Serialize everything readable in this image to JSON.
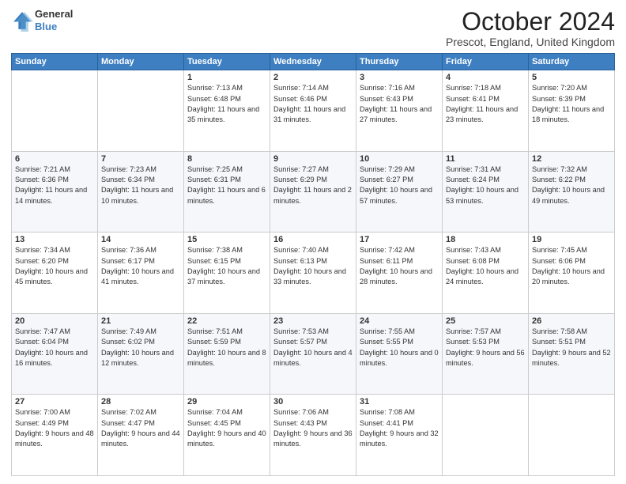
{
  "header": {
    "logo_line1": "General",
    "logo_line2": "Blue",
    "month": "October 2024",
    "location": "Prescot, England, United Kingdom"
  },
  "weekdays": [
    "Sunday",
    "Monday",
    "Tuesday",
    "Wednesday",
    "Thursday",
    "Friday",
    "Saturday"
  ],
  "weeks": [
    [
      {
        "day": "",
        "sunrise": "",
        "sunset": "",
        "daylight": ""
      },
      {
        "day": "",
        "sunrise": "",
        "sunset": "",
        "daylight": ""
      },
      {
        "day": "1",
        "sunrise": "Sunrise: 7:13 AM",
        "sunset": "Sunset: 6:48 PM",
        "daylight": "Daylight: 11 hours and 35 minutes."
      },
      {
        "day": "2",
        "sunrise": "Sunrise: 7:14 AM",
        "sunset": "Sunset: 6:46 PM",
        "daylight": "Daylight: 11 hours and 31 minutes."
      },
      {
        "day": "3",
        "sunrise": "Sunrise: 7:16 AM",
        "sunset": "Sunset: 6:43 PM",
        "daylight": "Daylight: 11 hours and 27 minutes."
      },
      {
        "day": "4",
        "sunrise": "Sunrise: 7:18 AM",
        "sunset": "Sunset: 6:41 PM",
        "daylight": "Daylight: 11 hours and 23 minutes."
      },
      {
        "day": "5",
        "sunrise": "Sunrise: 7:20 AM",
        "sunset": "Sunset: 6:39 PM",
        "daylight": "Daylight: 11 hours and 18 minutes."
      }
    ],
    [
      {
        "day": "6",
        "sunrise": "Sunrise: 7:21 AM",
        "sunset": "Sunset: 6:36 PM",
        "daylight": "Daylight: 11 hours and 14 minutes."
      },
      {
        "day": "7",
        "sunrise": "Sunrise: 7:23 AM",
        "sunset": "Sunset: 6:34 PM",
        "daylight": "Daylight: 11 hours and 10 minutes."
      },
      {
        "day": "8",
        "sunrise": "Sunrise: 7:25 AM",
        "sunset": "Sunset: 6:31 PM",
        "daylight": "Daylight: 11 hours and 6 minutes."
      },
      {
        "day": "9",
        "sunrise": "Sunrise: 7:27 AM",
        "sunset": "Sunset: 6:29 PM",
        "daylight": "Daylight: 11 hours and 2 minutes."
      },
      {
        "day": "10",
        "sunrise": "Sunrise: 7:29 AM",
        "sunset": "Sunset: 6:27 PM",
        "daylight": "Daylight: 10 hours and 57 minutes."
      },
      {
        "day": "11",
        "sunrise": "Sunrise: 7:31 AM",
        "sunset": "Sunset: 6:24 PM",
        "daylight": "Daylight: 10 hours and 53 minutes."
      },
      {
        "day": "12",
        "sunrise": "Sunrise: 7:32 AM",
        "sunset": "Sunset: 6:22 PM",
        "daylight": "Daylight: 10 hours and 49 minutes."
      }
    ],
    [
      {
        "day": "13",
        "sunrise": "Sunrise: 7:34 AM",
        "sunset": "Sunset: 6:20 PM",
        "daylight": "Daylight: 10 hours and 45 minutes."
      },
      {
        "day": "14",
        "sunrise": "Sunrise: 7:36 AM",
        "sunset": "Sunset: 6:17 PM",
        "daylight": "Daylight: 10 hours and 41 minutes."
      },
      {
        "day": "15",
        "sunrise": "Sunrise: 7:38 AM",
        "sunset": "Sunset: 6:15 PM",
        "daylight": "Daylight: 10 hours and 37 minutes."
      },
      {
        "day": "16",
        "sunrise": "Sunrise: 7:40 AM",
        "sunset": "Sunset: 6:13 PM",
        "daylight": "Daylight: 10 hours and 33 minutes."
      },
      {
        "day": "17",
        "sunrise": "Sunrise: 7:42 AM",
        "sunset": "Sunset: 6:11 PM",
        "daylight": "Daylight: 10 hours and 28 minutes."
      },
      {
        "day": "18",
        "sunrise": "Sunrise: 7:43 AM",
        "sunset": "Sunset: 6:08 PM",
        "daylight": "Daylight: 10 hours and 24 minutes."
      },
      {
        "day": "19",
        "sunrise": "Sunrise: 7:45 AM",
        "sunset": "Sunset: 6:06 PM",
        "daylight": "Daylight: 10 hours and 20 minutes."
      }
    ],
    [
      {
        "day": "20",
        "sunrise": "Sunrise: 7:47 AM",
        "sunset": "Sunset: 6:04 PM",
        "daylight": "Daylight: 10 hours and 16 minutes."
      },
      {
        "day": "21",
        "sunrise": "Sunrise: 7:49 AM",
        "sunset": "Sunset: 6:02 PM",
        "daylight": "Daylight: 10 hours and 12 minutes."
      },
      {
        "day": "22",
        "sunrise": "Sunrise: 7:51 AM",
        "sunset": "Sunset: 5:59 PM",
        "daylight": "Daylight: 10 hours and 8 minutes."
      },
      {
        "day": "23",
        "sunrise": "Sunrise: 7:53 AM",
        "sunset": "Sunset: 5:57 PM",
        "daylight": "Daylight: 10 hours and 4 minutes."
      },
      {
        "day": "24",
        "sunrise": "Sunrise: 7:55 AM",
        "sunset": "Sunset: 5:55 PM",
        "daylight": "Daylight: 10 hours and 0 minutes."
      },
      {
        "day": "25",
        "sunrise": "Sunrise: 7:57 AM",
        "sunset": "Sunset: 5:53 PM",
        "daylight": "Daylight: 9 hours and 56 minutes."
      },
      {
        "day": "26",
        "sunrise": "Sunrise: 7:58 AM",
        "sunset": "Sunset: 5:51 PM",
        "daylight": "Daylight: 9 hours and 52 minutes."
      }
    ],
    [
      {
        "day": "27",
        "sunrise": "Sunrise: 7:00 AM",
        "sunset": "Sunset: 4:49 PM",
        "daylight": "Daylight: 9 hours and 48 minutes."
      },
      {
        "day": "28",
        "sunrise": "Sunrise: 7:02 AM",
        "sunset": "Sunset: 4:47 PM",
        "daylight": "Daylight: 9 hours and 44 minutes."
      },
      {
        "day": "29",
        "sunrise": "Sunrise: 7:04 AM",
        "sunset": "Sunset: 4:45 PM",
        "daylight": "Daylight: 9 hours and 40 minutes."
      },
      {
        "day": "30",
        "sunrise": "Sunrise: 7:06 AM",
        "sunset": "Sunset: 4:43 PM",
        "daylight": "Daylight: 9 hours and 36 minutes."
      },
      {
        "day": "31",
        "sunrise": "Sunrise: 7:08 AM",
        "sunset": "Sunset: 4:41 PM",
        "daylight": "Daylight: 9 hours and 32 minutes."
      },
      {
        "day": "",
        "sunrise": "",
        "sunset": "",
        "daylight": ""
      },
      {
        "day": "",
        "sunrise": "",
        "sunset": "",
        "daylight": ""
      }
    ]
  ]
}
